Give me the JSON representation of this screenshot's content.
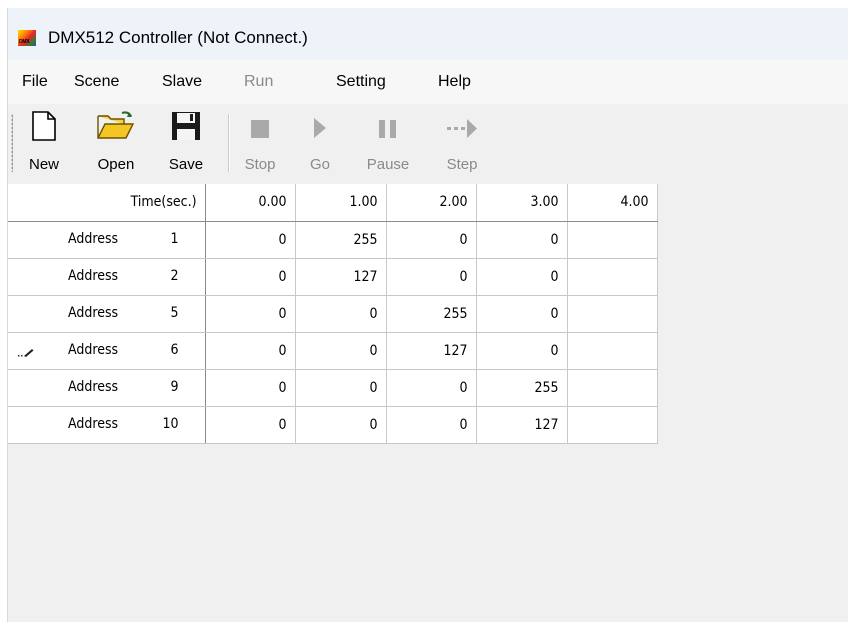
{
  "window": {
    "title": "DMX512 Controller (Not Connect.)",
    "icon_text": "DMX"
  },
  "menu": [
    {
      "label": "File",
      "enabled": true
    },
    {
      "label": "Scene",
      "enabled": true
    },
    {
      "label": "Slave",
      "enabled": true
    },
    {
      "label": "Run",
      "enabled": false
    },
    {
      "label": "Setting",
      "enabled": true
    },
    {
      "label": "Help",
      "enabled": true
    }
  ],
  "toolbar": {
    "new": "New",
    "open": "Open",
    "save": "Save",
    "stop": "Stop",
    "go": "Go",
    "pause": "Pause",
    "step": "Step"
  },
  "grid": {
    "header_label": "Time(sec.)",
    "times": [
      "0.00",
      "1.00",
      "2.00",
      "3.00",
      "4.00"
    ],
    "address_word": "Address",
    "rows": [
      {
        "address": "1",
        "values": [
          "0",
          "255",
          "0",
          "0",
          ""
        ]
      },
      {
        "address": "2",
        "values": [
          "0",
          "127",
          "0",
          "0",
          ""
        ]
      },
      {
        "address": "5",
        "values": [
          "0",
          "0",
          "255",
          "0",
          ""
        ]
      },
      {
        "address": "6",
        "values": [
          "0",
          "0",
          "127",
          "0",
          ""
        ],
        "editing": true
      },
      {
        "address": "9",
        "values": [
          "0",
          "0",
          "0",
          "255",
          ""
        ]
      },
      {
        "address": "10",
        "values": [
          "0",
          "0",
          "0",
          "127",
          ""
        ]
      }
    ]
  },
  "colors": {
    "titlebar": "#eef2f9",
    "menubar": "#f7f7f7",
    "window": "#f0f0f0",
    "disabled_text": "#8a8a8a"
  }
}
